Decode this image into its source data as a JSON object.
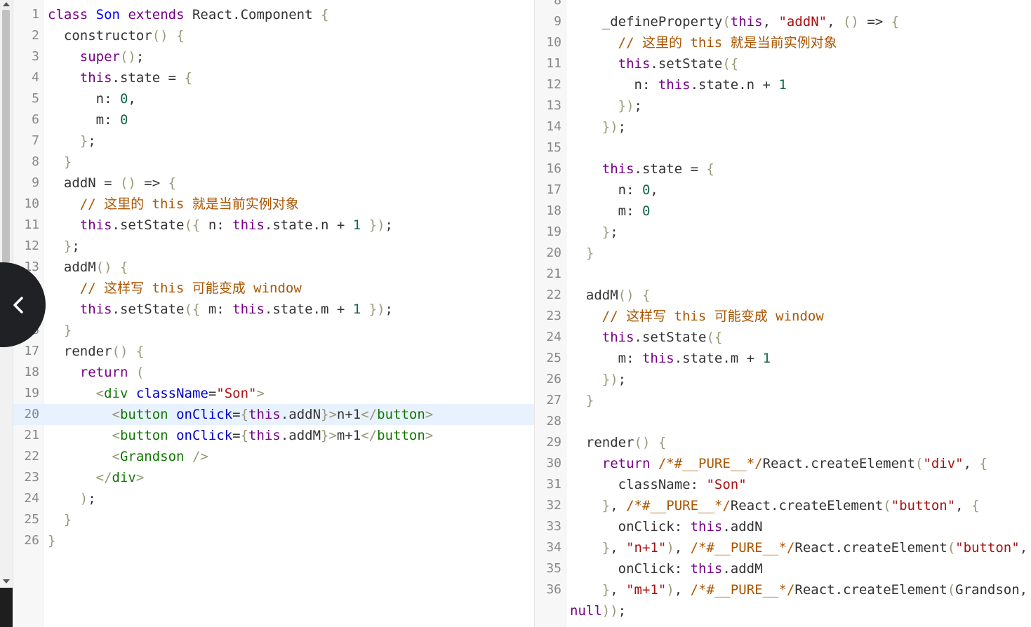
{
  "left_editor": {
    "active_line": 20,
    "lines": [
      {
        "n": "1",
        "t": [
          [
            "kw",
            "class"
          ],
          [
            "txt",
            " "
          ],
          [
            "def",
            "Son"
          ],
          [
            "txt",
            " "
          ],
          [
            "kw",
            "extends"
          ],
          [
            "txt",
            " React.Component "
          ],
          [
            "brk",
            "{"
          ]
        ]
      },
      {
        "n": "2",
        "t": [
          [
            "txt",
            "  constructor"
          ],
          [
            "brk",
            "()"
          ],
          [
            "txt",
            " "
          ],
          [
            "brk",
            "{"
          ]
        ]
      },
      {
        "n": "3",
        "t": [
          [
            "txt",
            "    "
          ],
          [
            "kw",
            "super"
          ],
          [
            "brk",
            "()"
          ],
          [
            "txt",
            ";"
          ]
        ]
      },
      {
        "n": "4",
        "t": [
          [
            "txt",
            "    "
          ],
          [
            "kw",
            "this"
          ],
          [
            "txt",
            ".state = "
          ],
          [
            "brk",
            "{"
          ]
        ]
      },
      {
        "n": "5",
        "t": [
          [
            "txt",
            "      n: "
          ],
          [
            "num",
            "0"
          ],
          [
            "txt",
            ","
          ]
        ]
      },
      {
        "n": "6",
        "t": [
          [
            "txt",
            "      m: "
          ],
          [
            "num",
            "0"
          ]
        ]
      },
      {
        "n": "7",
        "t": [
          [
            "txt",
            "    "
          ],
          [
            "brk",
            "}"
          ],
          [
            "txt",
            ";"
          ]
        ]
      },
      {
        "n": "8",
        "t": [
          [
            "txt",
            "  "
          ],
          [
            "brk",
            "}"
          ]
        ]
      },
      {
        "n": "9",
        "t": [
          [
            "txt",
            "  addN = "
          ],
          [
            "brk",
            "()"
          ],
          [
            "txt",
            " => "
          ],
          [
            "brk",
            "{"
          ]
        ]
      },
      {
        "n": "10",
        "t": [
          [
            "txt",
            "    "
          ],
          [
            "com",
            "// 这里的 this 就是当前实例对象"
          ]
        ]
      },
      {
        "n": "11",
        "t": [
          [
            "txt",
            "    "
          ],
          [
            "kw",
            "this"
          ],
          [
            "txt",
            ".setState"
          ],
          [
            "brk",
            "({"
          ],
          [
            "txt",
            " n: "
          ],
          [
            "kw",
            "this"
          ],
          [
            "txt",
            ".state.n + "
          ],
          [
            "num",
            "1"
          ],
          [
            "txt",
            " "
          ],
          [
            "brk",
            "})"
          ],
          [
            "txt",
            ";"
          ]
        ]
      },
      {
        "n": "12",
        "t": [
          [
            "txt",
            "  "
          ],
          [
            "brk",
            "}"
          ],
          [
            "txt",
            ";"
          ]
        ]
      },
      {
        "n": "13",
        "t": [
          [
            "txt",
            "  addM"
          ],
          [
            "brk",
            "()"
          ],
          [
            "txt",
            " "
          ],
          [
            "brk",
            "{"
          ]
        ]
      },
      {
        "n": "14",
        "t": [
          [
            "txt",
            "    "
          ],
          [
            "com",
            "// 这样写 this 可能变成 window"
          ]
        ]
      },
      {
        "n": "15",
        "t": [
          [
            "txt",
            "    "
          ],
          [
            "kw",
            "this"
          ],
          [
            "txt",
            ".setState"
          ],
          [
            "brk",
            "({"
          ],
          [
            "txt",
            " m: "
          ],
          [
            "kw",
            "this"
          ],
          [
            "txt",
            ".state.m + "
          ],
          [
            "num",
            "1"
          ],
          [
            "txt",
            " "
          ],
          [
            "brk",
            "})"
          ],
          [
            "txt",
            ";"
          ]
        ]
      },
      {
        "n": "16",
        "t": [
          [
            "txt",
            "  "
          ],
          [
            "brk",
            "}"
          ]
        ]
      },
      {
        "n": "17",
        "t": [
          [
            "txt",
            "  render"
          ],
          [
            "brk",
            "()"
          ],
          [
            "txt",
            " "
          ],
          [
            "brk",
            "{"
          ]
        ]
      },
      {
        "n": "18",
        "t": [
          [
            "txt",
            "    "
          ],
          [
            "kw",
            "return"
          ],
          [
            "txt",
            " "
          ],
          [
            "brk",
            "("
          ]
        ]
      },
      {
        "n": "19",
        "t": [
          [
            "txt",
            "      "
          ],
          [
            "brk",
            "<"
          ],
          [
            "tag",
            "div"
          ],
          [
            "txt",
            " "
          ],
          [
            "attr",
            "className"
          ],
          [
            "txt",
            "="
          ],
          [
            "str",
            "\"Son\""
          ],
          [
            "brk",
            ">"
          ]
        ]
      },
      {
        "n": "20",
        "t": [
          [
            "txt",
            "        "
          ],
          [
            "brk",
            "<"
          ],
          [
            "tag",
            "button"
          ],
          [
            "txt",
            " "
          ],
          [
            "attr",
            "onClick"
          ],
          [
            "txt",
            "="
          ],
          [
            "brk",
            "{"
          ],
          [
            "kw",
            "this"
          ],
          [
            "txt",
            ".addN"
          ],
          [
            "brk",
            "}"
          ],
          [
            "brk",
            ">"
          ],
          [
            "txt",
            "n+1"
          ],
          [
            "brk",
            "</"
          ],
          [
            "tag",
            "button"
          ],
          [
            "brk",
            ">"
          ]
        ]
      },
      {
        "n": "21",
        "t": [
          [
            "txt",
            "        "
          ],
          [
            "brk",
            "<"
          ],
          [
            "tag",
            "button"
          ],
          [
            "txt",
            " "
          ],
          [
            "attr",
            "onClick"
          ],
          [
            "txt",
            "="
          ],
          [
            "brk",
            "{"
          ],
          [
            "kw",
            "this"
          ],
          [
            "txt",
            ".addM"
          ],
          [
            "brk",
            "}"
          ],
          [
            "brk",
            ">"
          ],
          [
            "txt",
            "m+1"
          ],
          [
            "brk",
            "</"
          ],
          [
            "tag",
            "button"
          ],
          [
            "brk",
            ">"
          ]
        ]
      },
      {
        "n": "22",
        "t": [
          [
            "txt",
            "        "
          ],
          [
            "brk",
            "<"
          ],
          [
            "tag",
            "Grandson"
          ],
          [
            "txt",
            " "
          ],
          [
            "brk",
            "/>"
          ]
        ]
      },
      {
        "n": "23",
        "t": [
          [
            "txt",
            "      "
          ],
          [
            "brk",
            "</"
          ],
          [
            "tag",
            "div"
          ],
          [
            "brk",
            ">"
          ]
        ]
      },
      {
        "n": "24",
        "t": [
          [
            "txt",
            "    "
          ],
          [
            "brk",
            ")"
          ],
          [
            "txt",
            ";"
          ]
        ]
      },
      {
        "n": "25",
        "t": [
          [
            "txt",
            "  "
          ],
          [
            "brk",
            "}"
          ]
        ]
      },
      {
        "n": "26",
        "t": [
          [
            "brk",
            "}"
          ]
        ]
      }
    ]
  },
  "right_editor": {
    "lines": [
      {
        "n": "8",
        "t": []
      },
      {
        "n": "9",
        "t": [
          [
            "txt",
            "    _defineProperty"
          ],
          [
            "brk",
            "("
          ],
          [
            "kw",
            "this"
          ],
          [
            "txt",
            ", "
          ],
          [
            "str",
            "\"addN\""
          ],
          [
            "txt",
            ", "
          ],
          [
            "brk",
            "()"
          ],
          [
            "txt",
            " => "
          ],
          [
            "brk",
            "{"
          ]
        ]
      },
      {
        "n": "10",
        "t": [
          [
            "txt",
            "      "
          ],
          [
            "com",
            "// 这里的 this 就是当前实例对象"
          ]
        ]
      },
      {
        "n": "11",
        "t": [
          [
            "txt",
            "      "
          ],
          [
            "kw",
            "this"
          ],
          [
            "txt",
            ".setState"
          ],
          [
            "brk",
            "({"
          ]
        ]
      },
      {
        "n": "12",
        "t": [
          [
            "txt",
            "        n: "
          ],
          [
            "kw",
            "this"
          ],
          [
            "txt",
            ".state.n + "
          ],
          [
            "num",
            "1"
          ]
        ]
      },
      {
        "n": "13",
        "t": [
          [
            "txt",
            "      "
          ],
          [
            "brk",
            "})"
          ],
          [
            "txt",
            ";"
          ]
        ]
      },
      {
        "n": "14",
        "t": [
          [
            "txt",
            "    "
          ],
          [
            "brk",
            "})"
          ],
          [
            "txt",
            ";"
          ]
        ]
      },
      {
        "n": "15",
        "t": []
      },
      {
        "n": "16",
        "t": [
          [
            "txt",
            "    "
          ],
          [
            "kw",
            "this"
          ],
          [
            "txt",
            ".state = "
          ],
          [
            "brk",
            "{"
          ]
        ]
      },
      {
        "n": "17",
        "t": [
          [
            "txt",
            "      n: "
          ],
          [
            "num",
            "0"
          ],
          [
            "txt",
            ","
          ]
        ]
      },
      {
        "n": "18",
        "t": [
          [
            "txt",
            "      m: "
          ],
          [
            "num",
            "0"
          ]
        ]
      },
      {
        "n": "19",
        "t": [
          [
            "txt",
            "    "
          ],
          [
            "brk",
            "}"
          ],
          [
            "txt",
            ";"
          ]
        ]
      },
      {
        "n": "20",
        "t": [
          [
            "txt",
            "  "
          ],
          [
            "brk",
            "}"
          ]
        ]
      },
      {
        "n": "21",
        "t": []
      },
      {
        "n": "22",
        "t": [
          [
            "txt",
            "  addM"
          ],
          [
            "brk",
            "()"
          ],
          [
            "txt",
            " "
          ],
          [
            "brk",
            "{"
          ]
        ]
      },
      {
        "n": "23",
        "t": [
          [
            "txt",
            "    "
          ],
          [
            "com",
            "// 这样写 this 可能变成 window"
          ]
        ]
      },
      {
        "n": "24",
        "t": [
          [
            "txt",
            "    "
          ],
          [
            "kw",
            "this"
          ],
          [
            "txt",
            ".setState"
          ],
          [
            "brk",
            "({"
          ]
        ]
      },
      {
        "n": "25",
        "t": [
          [
            "txt",
            "      m: "
          ],
          [
            "kw",
            "this"
          ],
          [
            "txt",
            ".state.m + "
          ],
          [
            "num",
            "1"
          ]
        ]
      },
      {
        "n": "26",
        "t": [
          [
            "txt",
            "    "
          ],
          [
            "brk",
            "})"
          ],
          [
            "txt",
            ";"
          ]
        ]
      },
      {
        "n": "27",
        "t": [
          [
            "txt",
            "  "
          ],
          [
            "brk",
            "}"
          ]
        ]
      },
      {
        "n": "28",
        "t": []
      },
      {
        "n": "29",
        "t": [
          [
            "txt",
            "  render"
          ],
          [
            "brk",
            "()"
          ],
          [
            "txt",
            " "
          ],
          [
            "brk",
            "{"
          ]
        ]
      },
      {
        "n": "30",
        "t": [
          [
            "txt",
            "    "
          ],
          [
            "kw",
            "return"
          ],
          [
            "txt",
            " "
          ],
          [
            "com",
            "/*#__PURE__*/"
          ],
          [
            "txt",
            "React.createElement"
          ],
          [
            "brk",
            "("
          ],
          [
            "str",
            "\"div\""
          ],
          [
            "txt",
            ", "
          ],
          [
            "brk",
            "{"
          ]
        ]
      },
      {
        "n": "31",
        "t": [
          [
            "txt",
            "      className: "
          ],
          [
            "str",
            "\"Son\""
          ]
        ]
      },
      {
        "n": "32",
        "t": [
          [
            "txt",
            "    "
          ],
          [
            "brk",
            "}"
          ],
          [
            "txt",
            ", "
          ],
          [
            "com",
            "/*#__PURE__*/"
          ],
          [
            "txt",
            "React.createElement"
          ],
          [
            "brk",
            "("
          ],
          [
            "str",
            "\"button\""
          ],
          [
            "txt",
            ", "
          ],
          [
            "brk",
            "{"
          ]
        ]
      },
      {
        "n": "33",
        "t": [
          [
            "txt",
            "      onClick: "
          ],
          [
            "kw",
            "this"
          ],
          [
            "txt",
            ".addN"
          ]
        ]
      },
      {
        "n": "34",
        "t": [
          [
            "txt",
            "    "
          ],
          [
            "brk",
            "}"
          ],
          [
            "txt",
            ", "
          ],
          [
            "str",
            "\"n+1\""
          ],
          [
            "brk",
            ")"
          ],
          [
            "txt",
            ", "
          ],
          [
            "com",
            "/*#__PURE__*/"
          ],
          [
            "txt",
            "React.createElement"
          ],
          [
            "brk",
            "("
          ],
          [
            "str",
            "\"button\""
          ],
          [
            "txt",
            ", "
          ],
          [
            "brk",
            "{"
          ]
        ]
      },
      {
        "n": "35",
        "t": [
          [
            "txt",
            "      onClick: "
          ],
          [
            "kw",
            "this"
          ],
          [
            "txt",
            ".addM"
          ]
        ]
      },
      {
        "n": "36",
        "t": [
          [
            "txt",
            "    "
          ],
          [
            "brk",
            "}"
          ],
          [
            "txt",
            ", "
          ],
          [
            "str",
            "\"m+1\""
          ],
          [
            "brk",
            ")"
          ],
          [
            "txt",
            ", "
          ],
          [
            "com",
            "/*#__PURE__*/"
          ],
          [
            "txt",
            "React.createElement"
          ],
          [
            "brk",
            "("
          ],
          [
            "txt",
            "Grandson,"
          ]
        ]
      },
      {
        "n": "",
        "t": [
          [
            "kw",
            "null"
          ],
          [
            "brk",
            "))"
          ],
          [
            "txt",
            ";"
          ]
        ]
      }
    ]
  },
  "icons": {
    "collapse": "chevron-left-icon",
    "scroll_up": "arrow-up-icon",
    "scroll_down": "arrow-down-icon"
  },
  "colors": {
    "keyword": "#770088",
    "def": "#0000ff",
    "string": "#aa1111",
    "number": "#116644",
    "comment": "#aa5500",
    "tag": "#117700",
    "attribute": "#0000cc",
    "bracket": "#999977",
    "active_line_bg": "#e8f2ff",
    "collapse_button_bg": "#202124"
  }
}
